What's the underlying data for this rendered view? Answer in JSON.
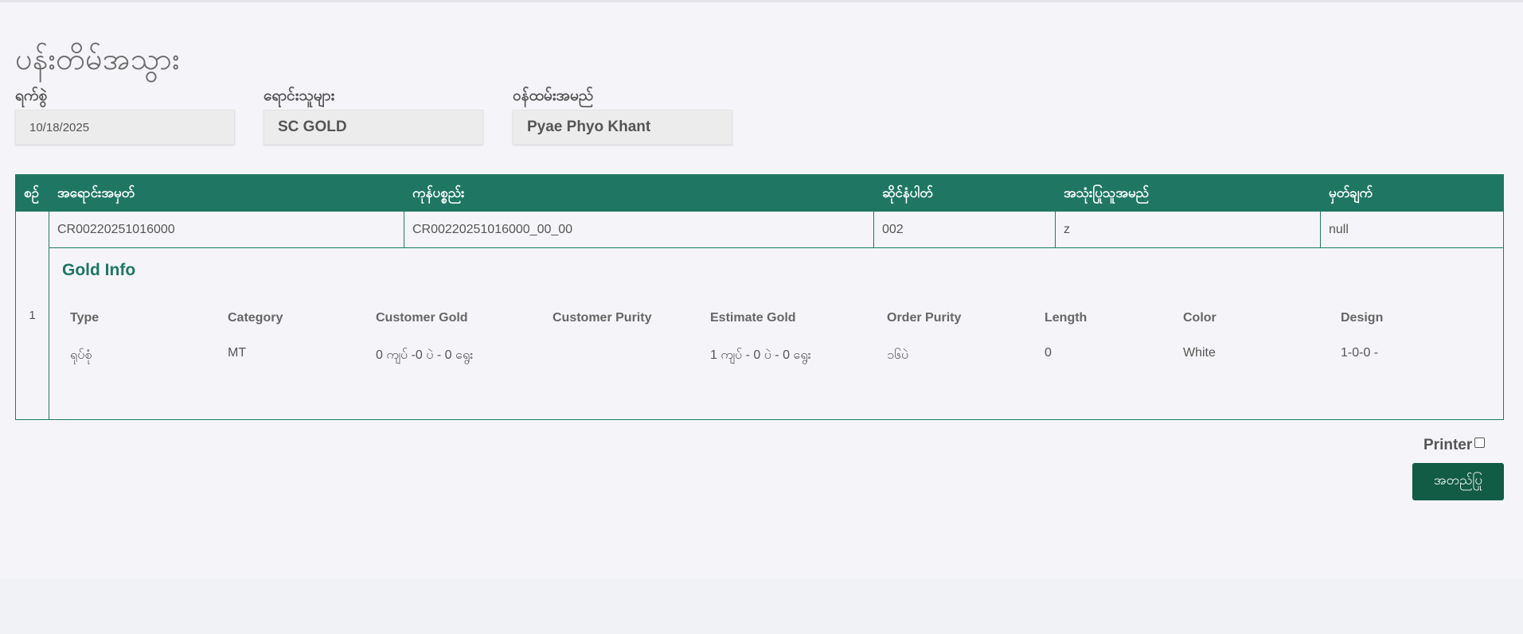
{
  "page": {
    "title": "ပန်းတိမ်အသွား"
  },
  "fields": {
    "date_label": "ရက်စွဲ",
    "date_value": "10/18/2025",
    "seller_label": "ရောင်းသူများ",
    "seller_value": "SC GOLD",
    "staff_label": "ဝန်ထမ်းအမည်",
    "staff_value": "Pyae Phyo Khant"
  },
  "table": {
    "headers": [
      "စဉ်",
      "အရောင်းအမှတ်",
      "ကုန်ပစ္စည်း",
      "ဆိုင်နံပါတ်",
      "အသုံးပြုသူအမည်",
      "မှတ်ချက်"
    ],
    "row": {
      "index": "1",
      "sale_no": "CR00220251016000",
      "product": "CR00220251016000_00_00",
      "shop_no": "002",
      "user_name": "z",
      "remark": "null"
    },
    "gold_info": {
      "title": "Gold Info",
      "headers": [
        "Type",
        "Category",
        "Customer Gold",
        "Customer Purity",
        "Estimate Gold",
        "Order Purity",
        "Length",
        "Color",
        "Design"
      ],
      "values": [
        "ရုပ်စုံ",
        "MT",
        "0 ကျပ် -0 ပဲ - 0 ရွေး",
        "",
        "1 ကျပ် - 0 ပဲ - 0 ရွေး",
        "၁၆ပဲ",
        "0",
        "White",
        "1-0-0 -"
      ]
    }
  },
  "printer": {
    "label": "Printer",
    "checked": false
  },
  "actions": {
    "confirm_label": "အတည်ပြု"
  },
  "colors": {
    "primary": "#1f7763",
    "button": "#125c45",
    "background": "#f5f5f9"
  }
}
